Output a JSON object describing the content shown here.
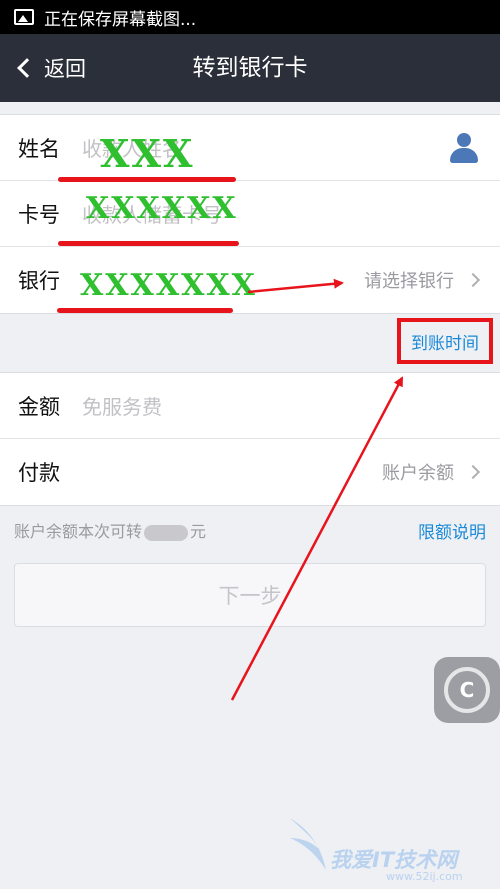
{
  "status_bar": {
    "text": "正在保存屏幕截图..."
  },
  "nav": {
    "back_label": "返回",
    "title": "转到银行卡"
  },
  "form": {
    "name": {
      "label": "姓名",
      "placeholder": "收款人姓名",
      "handwritten": "XXX"
    },
    "card": {
      "label": "卡号",
      "placeholder": "收款人储蓄卡号",
      "handwritten": "XXXXXX"
    },
    "bank": {
      "label": "银行",
      "handwritten": "XXXXXXX",
      "select_text": "请选择银行"
    }
  },
  "arrival_time": "到账时间",
  "amount": {
    "label": "金额",
    "placeholder": "免服务费"
  },
  "payment": {
    "label": "付款",
    "value": "账户余额"
  },
  "balance_hint": {
    "prefix": "账户余额本次可转",
    "suffix": "元"
  },
  "limit_link": "限额说明",
  "next_button": "下一步",
  "float_button": "C",
  "watermark": {
    "text": "我爱IT技术网",
    "url": "www.52ij.com"
  },
  "colors": {
    "accent_blue": "#1a8ad8",
    "annotation_red": "#e8141c",
    "handwriting_green": "#2fbf2f",
    "nav_bg": "#2b2f39"
  }
}
